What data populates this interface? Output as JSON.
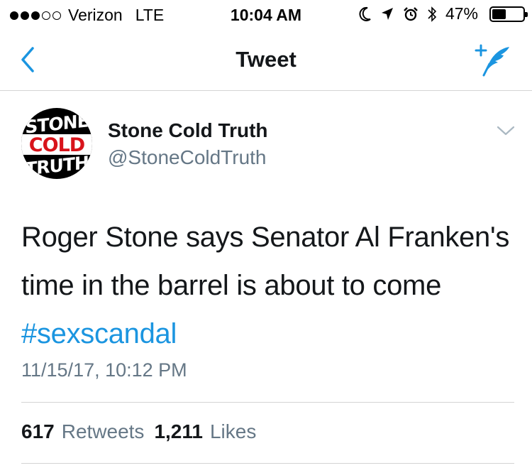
{
  "status_bar": {
    "carrier": "Verizon",
    "network": "LTE",
    "time": "10:04 AM",
    "battery": "47%",
    "battery_level": 0.47
  },
  "nav": {
    "title": "Tweet",
    "accent_color": "#1b95e0"
  },
  "tweet": {
    "avatar": {
      "line1": "STONE",
      "line2": "COLD",
      "line3": "TRUTH"
    },
    "display_name": "Stone Cold Truth",
    "handle": "@StoneColdTruth",
    "text": "Roger Stone says Senator Al Franken's time in the barrel is about to come ",
    "hashtag": "#sexscandal",
    "timestamp": "11/15/17, 10:12 PM",
    "retweets_count": "617",
    "retweets_label": "Retweets",
    "likes_count": "1,211",
    "likes_label": "Likes"
  }
}
